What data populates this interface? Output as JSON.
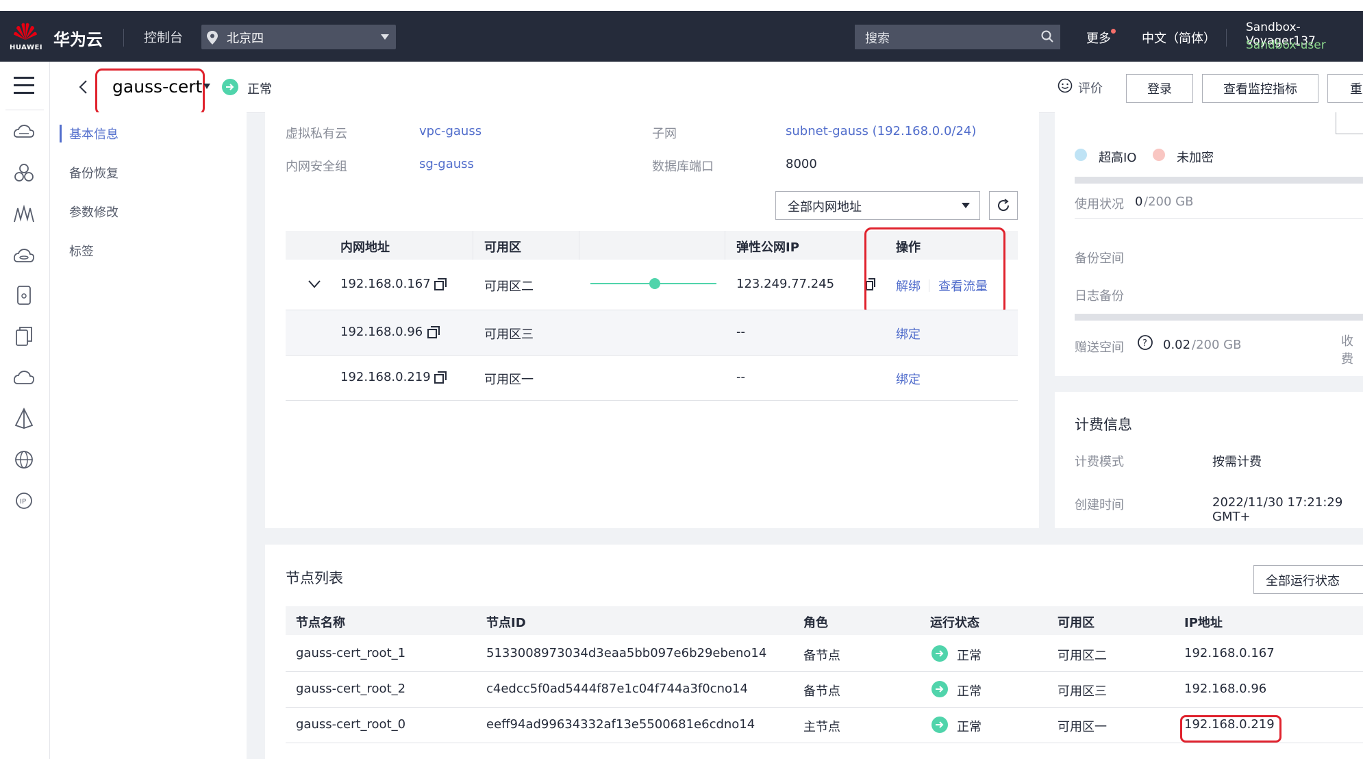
{
  "topbar": {
    "brand": "华为云",
    "logo_text": "HUAWEI",
    "console": "控制台",
    "region": "北京四",
    "search_placeholder": "搜索",
    "more": "更多",
    "language": "中文（简体）",
    "account": "Sandbox-Voyager137",
    "user": "Sandbox-user"
  },
  "header": {
    "title": "gauss-cert",
    "status": "正常",
    "rate": "评价",
    "login_btn": "登录",
    "monitor_btn": "查看监控指标",
    "restart_btn": "重启"
  },
  "sidebar": {
    "items": [
      {
        "label": "基本信息",
        "active": true
      },
      {
        "label": "备份恢复"
      },
      {
        "label": "参数修改"
      },
      {
        "label": "标签"
      }
    ]
  },
  "network": {
    "vpc_label": "虚拟私有云",
    "vpc_value": "vpc-gauss",
    "subnet_label": "子网",
    "subnet_value": "subnet-gauss (192.168.0.0/24)",
    "sg_label": "内网安全组",
    "sg_value": "sg-gauss",
    "port_label": "数据库端口",
    "port_value": "8000",
    "filter": "全部内网地址",
    "columns": [
      "内网地址",
      "可用区",
      "弹性公网IP",
      "操作"
    ],
    "rows": [
      {
        "ip": "192.168.0.167",
        "az": "可用区二",
        "eip": "123.249.77.245",
        "op1": "解绑",
        "op2": "查看流量"
      },
      {
        "ip": "192.168.0.96",
        "az": "可用区三",
        "eip": "--",
        "op1": "绑定"
      },
      {
        "ip": "192.168.0.219",
        "az": "可用区一",
        "eip": "--",
        "op1": "绑定"
      }
    ]
  },
  "storage": {
    "io_type": "超高IO",
    "encrypt": "未加密",
    "usage_label": "使用状况",
    "usage_value": "0",
    "usage_total": "/200 GB",
    "backup_label": "备份空间",
    "log_label": "日志备份",
    "gift_label": "赠送空间",
    "gift_value": "0.02",
    "gift_total": "/200 GB",
    "charge": "收费"
  },
  "billing": {
    "title": "计费信息",
    "mode_label": "计费模式",
    "mode_value": "按需计费",
    "created_label": "创建时间",
    "created_value": "2022/11/30 17:21:29 GMT+"
  },
  "nodes": {
    "title": "节点列表",
    "filter": "全部运行状态",
    "columns": [
      "节点名称",
      "节点ID",
      "角色",
      "运行状态",
      "可用区",
      "IP地址"
    ],
    "rows": [
      {
        "name": "gauss-cert_root_1",
        "id": "5133008973034d3eaa5bb097e6b29ebeno14",
        "role": "备节点",
        "status": "正常",
        "az": "可用区二",
        "ip": "192.168.0.167"
      },
      {
        "name": "gauss-cert_root_2",
        "id": "c4edcc5f0ad5444f87e1c04f744a3f0cno14",
        "role": "备节点",
        "status": "正常",
        "az": "可用区三",
        "ip": "192.168.0.96"
      },
      {
        "name": "gauss-cert_root_0",
        "id": "eeff94ad99634332af13e5500681e6cdno14",
        "role": "主节点",
        "status": "正常",
        "az": "可用区一",
        "ip": "192.168.0.219"
      }
    ]
  },
  "colors": {
    "accent": "#526ecc",
    "topbar": "#252b3a",
    "ok": "#50d4ab",
    "highlight": "#e0222d"
  }
}
